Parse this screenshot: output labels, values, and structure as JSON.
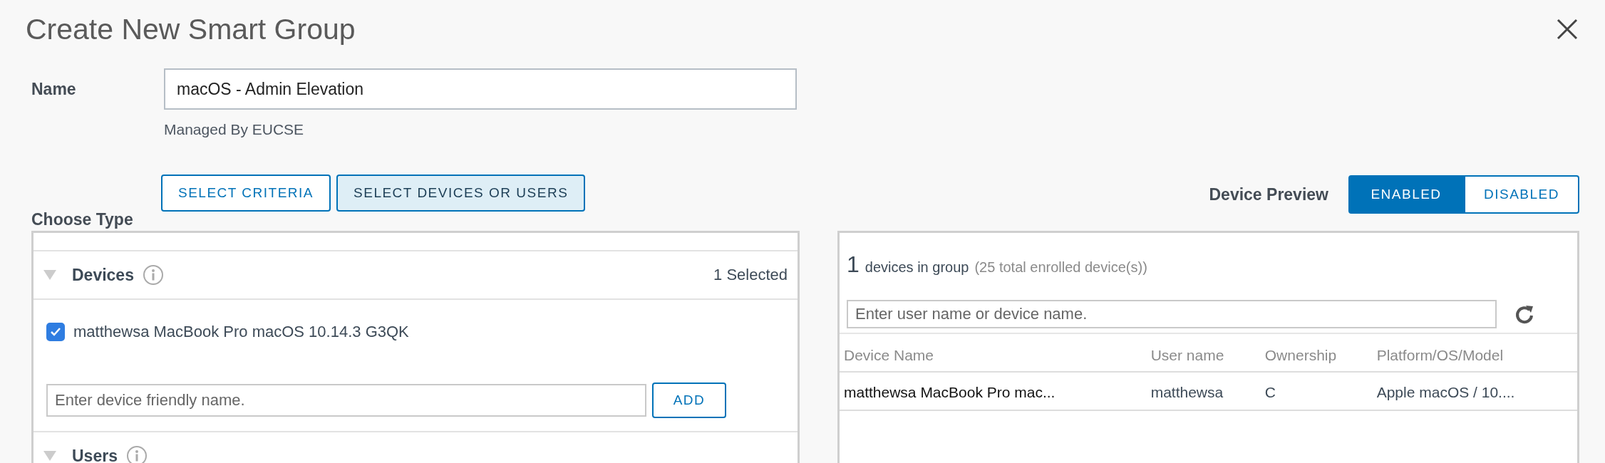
{
  "dialog": {
    "title": "Create New Smart Group"
  },
  "name_field": {
    "label": "Name",
    "value": "macOS - Admin Elevation",
    "note": "Managed By EUCSE"
  },
  "choose_type": {
    "label": "Choose Type",
    "options": [
      {
        "label": "SELECT CRITERIA",
        "selected": false
      },
      {
        "label": "SELECT DEVICES OR USERS",
        "selected": true
      }
    ]
  },
  "device_preview": {
    "label": "Device Preview",
    "options": [
      {
        "label": "ENABLED",
        "selected": true
      },
      {
        "label": "DISABLED",
        "selected": false
      }
    ]
  },
  "sections": [
    {
      "title": "Devices",
      "expanded": true,
      "count": "1 Selected",
      "items": [
        {
          "label": "matthewsa MacBook Pro macOS 10.14.3 G3QK",
          "checked": true
        }
      ],
      "input": {
        "placeholder": "Enter device friendly name."
      },
      "add_button": "ADD"
    },
    {
      "title": "Users",
      "expanded": true
    }
  ],
  "preview": {
    "count": "1",
    "count_label": "devices in group",
    "total": "(25 total enrolled device(s))",
    "search": {
      "placeholder": "Enter user name or device name."
    },
    "columns": [
      "Device Name",
      "User name",
      "Ownership",
      "Platform/OS/Model"
    ],
    "rows": [
      [
        "matthewsa MacBook Pro mac...",
        "matthewsa",
        "C",
        "Apple macOS / 10...."
      ]
    ]
  }
}
